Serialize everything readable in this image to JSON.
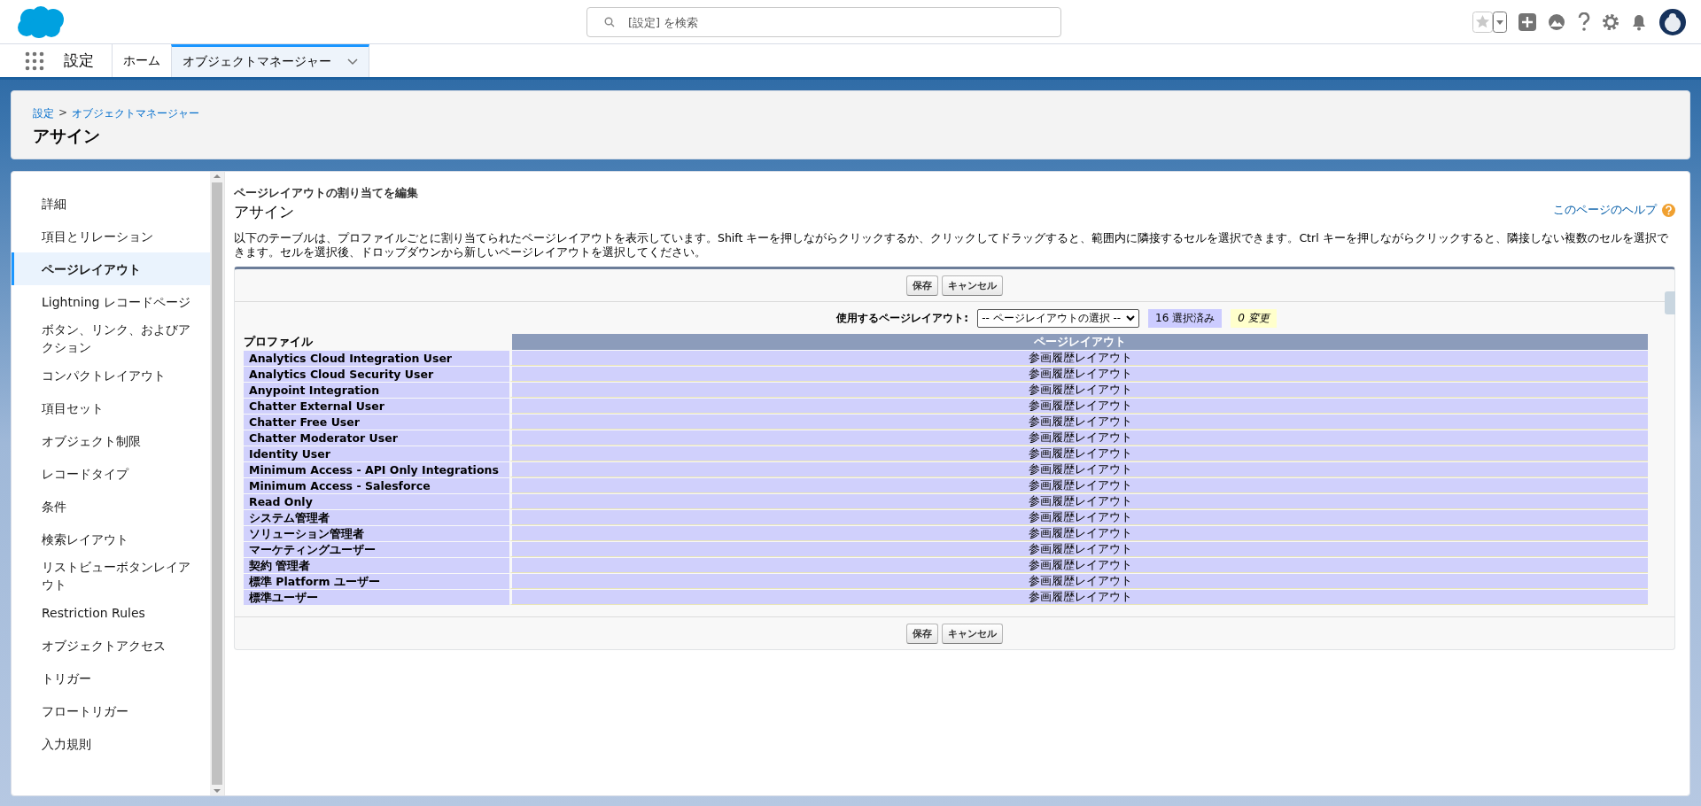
{
  "header": {
    "search_placeholder": "[設定] を検索"
  },
  "nav": {
    "app_name": "設定",
    "tabs": [
      {
        "label": "ホーム",
        "selected": false
      },
      {
        "label": "オブジェクトマネージャー",
        "selected": true
      }
    ]
  },
  "page_header": {
    "breadcrumb": [
      "設定",
      "オブジェクトマネージャー"
    ],
    "separator": ">",
    "title": "アサイン"
  },
  "sidebar": {
    "items": [
      {
        "label": "詳細",
        "selected": false
      },
      {
        "label": "項目とリレーション",
        "selected": false
      },
      {
        "label": "ページレイアウト",
        "selected": true
      },
      {
        "label": "Lightning レコードページ",
        "selected": false
      },
      {
        "label": "ボタン、リンク、およびアクション",
        "selected": false
      },
      {
        "label": "コンパクトレイアウト",
        "selected": false
      },
      {
        "label": "項目セット",
        "selected": false
      },
      {
        "label": "オブジェクト制限",
        "selected": false
      },
      {
        "label": "レコードタイプ",
        "selected": false
      },
      {
        "label": "条件",
        "selected": false
      },
      {
        "label": "検索レイアウト",
        "selected": false
      },
      {
        "label": "リストビューボタンレイアウト",
        "selected": false
      },
      {
        "label": "Restriction Rules",
        "selected": false
      },
      {
        "label": "オブジェクトアクセス",
        "selected": false
      },
      {
        "label": "トリガー",
        "selected": false
      },
      {
        "label": "フロートリガー",
        "selected": false
      },
      {
        "label": "入力規則",
        "selected": false
      }
    ]
  },
  "main": {
    "subtitle": "ページレイアウトの割り当てを編集",
    "title": "アサイン",
    "help_link": "このページのヘルプ",
    "description": "以下のテーブルは、プロファイルごとに割り当てられたページレイアウトを表示しています。Shift キーを押しながらクリックするか、クリックしてドラッグすると、範囲内に隣接するセルを選択できます。Ctrl キーを押しながらクリックすると、隣接しない複数のセルを選択できます。セルを選択後、ドロップダウンから新しいページレイアウトを選択してください。",
    "buttons_top": [
      "保存",
      "キャンセル"
    ],
    "layout_label": "使用するページレイアウト:",
    "layout_select": "-- ページレイアウトの選択 --",
    "selected_count": "16 選択済み",
    "changes": "0 変更",
    "table": {
      "columns": [
        "プロファイル",
        "ページレイアウト"
      ],
      "rows": [
        {
          "profile": "Analytics Cloud Integration User",
          "layout": "参画履歴レイアウト",
          "selected": true
        },
        {
          "profile": "Analytics Cloud Security User",
          "layout": "参画履歴レイアウト",
          "selected": true
        },
        {
          "profile": "Anypoint Integration",
          "layout": "参画履歴レイアウト",
          "selected": true
        },
        {
          "profile": "Chatter External User",
          "layout": "参画履歴レイアウト",
          "selected": true
        },
        {
          "profile": "Chatter Free User",
          "layout": "参画履歴レイアウト",
          "selected": true
        },
        {
          "profile": "Chatter Moderator User",
          "layout": "参画履歴レイアウト",
          "selected": true
        },
        {
          "profile": "Identity User",
          "layout": "参画履歴レイアウト",
          "selected": true
        },
        {
          "profile": "Minimum Access - API Only Integrations",
          "layout": "参画履歴レイアウト",
          "selected": true
        },
        {
          "profile": "Minimum Access - Salesforce",
          "layout": "参画履歴レイアウト",
          "selected": true
        },
        {
          "profile": "Read Only",
          "layout": "参画履歴レイアウト",
          "selected": true
        },
        {
          "profile": "システム管理者",
          "layout": "参画履歴レイアウト",
          "selected": true
        },
        {
          "profile": "ソリューション管理者",
          "layout": "参画履歴レイアウト",
          "selected": true
        },
        {
          "profile": "マーケティングユーザー",
          "layout": "参画履歴レイアウト",
          "selected": true
        },
        {
          "profile": "契約 管理者",
          "layout": "参画履歴レイアウト",
          "selected": true
        },
        {
          "profile": "標準 Platform ユーザー",
          "layout": "参画履歴レイアウト",
          "selected": true
        },
        {
          "profile": "標準ユーザー",
          "layout": "参画履歴レイアウト",
          "selected": true
        }
      ]
    },
    "buttons_bottom": [
      "保存",
      "キャンセル"
    ]
  }
}
